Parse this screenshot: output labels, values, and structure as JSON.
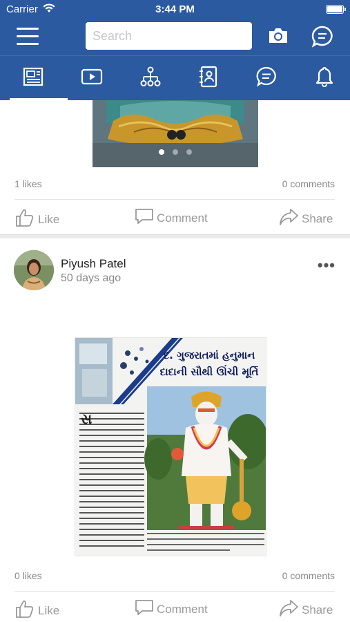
{
  "status_bar": {
    "carrier": "Carrier",
    "time": "3:44 PM"
  },
  "header": {
    "search_placeholder": "Search"
  },
  "nav_tabs": [
    {
      "name": "news-icon",
      "active": true
    },
    {
      "name": "video-icon",
      "active": false
    },
    {
      "name": "org-chart-icon",
      "active": false
    },
    {
      "name": "contacts-icon",
      "active": false
    },
    {
      "name": "chat-icon",
      "active": false
    },
    {
      "name": "bell-icon",
      "active": false
    }
  ],
  "posts": [
    {
      "likes": "1 likes",
      "comments": "0 comments",
      "actions": {
        "like": "Like",
        "comment": "Comment",
        "share": "Share"
      }
    },
    {
      "author": "Piyush Patel",
      "time_ago": "50 days  ago",
      "image_title_line1": "દ. ગુજરાતમાં હનુમાન",
      "image_title_line2": "દાદાની સૌથી ઊંચી મૂર્તિ",
      "likes": "0 likes",
      "comments": "0 comments",
      "actions": {
        "like": "Like",
        "comment": "Comment",
        "share": "Share"
      }
    }
  ],
  "colors": {
    "brand": "#2c5aa0",
    "muted": "#999999"
  }
}
